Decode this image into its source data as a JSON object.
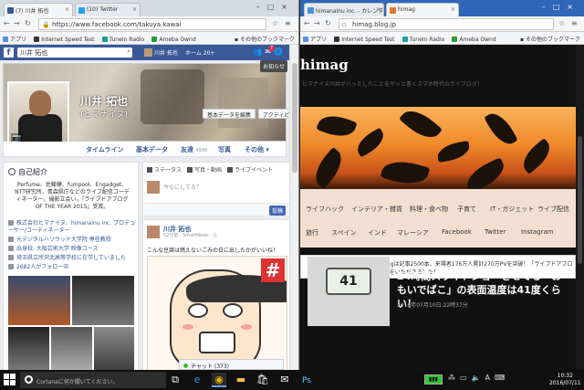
{
  "left_window": {
    "tabs": [
      {
        "label": "(7) 川井 拓也",
        "icon_color": "#3b5998",
        "active": true
      },
      {
        "label": "(10) Twitter",
        "icon_color": "#1da1f2",
        "active": false
      }
    ],
    "window_user": "",
    "address": "https://www.facebook.com/takuya.kawai",
    "bookmarks": [
      "アプリ",
      "Internet Speed Test",
      "TuneIn Radio",
      "Ameba Ownd",
      "その他のブックマーク"
    ],
    "facebook": {
      "logo": "f",
      "search_value": "川井 拓也",
      "user_name": "川井 拓也",
      "home_label": "ホーム",
      "home_count": "20+",
      "notification_count": "7",
      "notice_label": "お知らせ",
      "profile_name": "川井 拓也",
      "profile_alias": "(ヒマナイヌ)",
      "edit_profile_label": "基本データを編集",
      "activity_label": "アクティビ",
      "tabs": [
        {
          "label": "タイムライン",
          "count": ""
        },
        {
          "label": "基本データ",
          "count": ""
        },
        {
          "label": "友達",
          "count": "4998"
        },
        {
          "label": "写真",
          "count": ""
        },
        {
          "label": "その他 ▾",
          "count": ""
        }
      ],
      "intro": {
        "title": "自己紹介",
        "bio": "Perfume、佐藤健、fumpool、Engadget、NTT研究所、青森県庁などのライブ配信コーディネーター。撮影立会い。『ライブドアブログ OF THE YEAR 2015』受賞。",
        "rows": [
          "株式会社ヒマナイヌ、himanainu inc. プロデューサー/コーディネーター",
          "元デジタルハリウッド大学院 専任教授",
          "出身校: 大阪芸術大学 映像コース",
          "埼玉県立所沢北高等学校に在学していました",
          "2682人がフォロー中"
        ]
      },
      "composer": {
        "status_label": "ステータス",
        "photo_label": "写真・動画",
        "live_label": "ライブイベント",
        "placeholder": "今なにしてる？",
        "post_button": "投稿"
      },
      "post": {
        "author": "川井 拓也",
        "meta": "52分前 · SmartNews · ◎",
        "text": "こんな豆腐は燃えないごみの日に出したかがいいね！",
        "manga_mark": "#"
      },
      "chat": {
        "label": "チャット",
        "count": "(373)"
      }
    }
  },
  "right_window": {
    "tabs": [
      {
        "label": "himanainu inc. - カレンダ",
        "icon_color": "#4a90d9",
        "active": false
      },
      {
        "label": "himag",
        "icon_color": "#e07a2a",
        "active": true
      }
    ],
    "address": "himag.blog.jp",
    "bookmarks": [
      "アプリ",
      "Internet Speed Test",
      "TuneIn Radio",
      "Ameba Ownd",
      "その他のブックマーク"
    ],
    "blog": {
      "title": "himag",
      "tagline": "ヒマナイヌ川井がハッとしたことをサッと書くスマホ時代のライフログ！",
      "nav_row1": [
        "ライフハック",
        "インテリア・雑貨",
        "料理・食べ物",
        "子育て",
        "IT・ガジェット",
        "ライブ配信"
      ],
      "nav_row2": [
        "旅行",
        "スペイン",
        "インド",
        "マレーシア",
        "Facebook",
        "Twitter",
        "Instagram"
      ],
      "notice": "2015年4月15日にはじめたhimagは記事2500本、来場者176万人累計270万PVを突破！「ライブドアブログ OF THE YEAR 2015」話題賞をいただきました！",
      "article_title": "24時間スライドショーさせてる「おもいでばこ」の表面温度は41度くらい！",
      "article_date": "2016年07月10日 22時37分",
      "lcd_value": "41"
    }
  },
  "taskbar": {
    "cortana_placeholder": "Cortanaに何か聞いてください。",
    "apps": [
      "task-view",
      "edge",
      "chrome",
      "explorer",
      "store",
      "mail",
      "photoshop"
    ],
    "clock_time": "10:32",
    "clock_date": "2016/07/11"
  },
  "colors": {
    "facebook_blue": "#3b5998",
    "chrome_blue": "#2f66b8",
    "blog_bg": "#111111",
    "hero_orange": "#f08a2a"
  }
}
